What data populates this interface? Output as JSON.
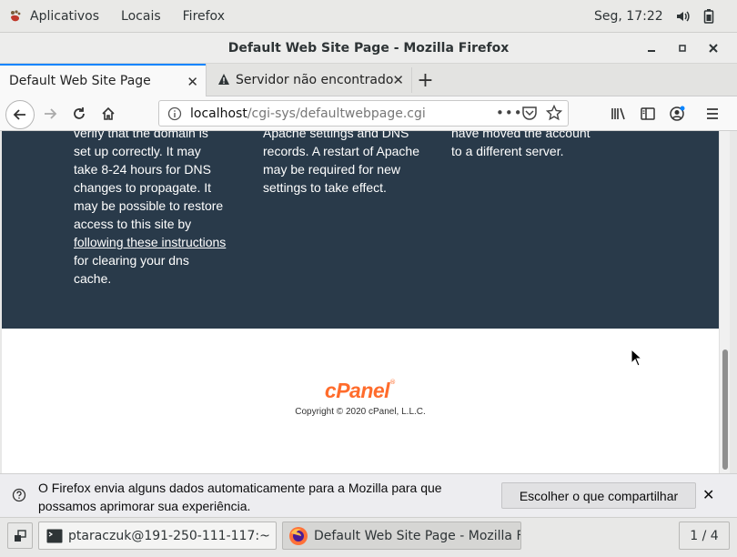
{
  "topbar": {
    "apps_label": "Aplicativos",
    "places_label": "Locais",
    "firefox_label": "Firefox",
    "clock": "Seg, 17:22"
  },
  "window": {
    "title": "Default Web Site Page - Mozilla Firefox"
  },
  "tabs": [
    {
      "label": "Default Web Site Page",
      "active": true
    },
    {
      "label": "Servidor não encontrado",
      "active": false
    }
  ],
  "urlbar": {
    "host": "localhost",
    "path": "/cgi-sys/defaultwebpage.cgi"
  },
  "page": {
    "col1": {
      "line0": "verify that the domain is",
      "text_before": "set up correctly. It may take 8-24 hours for DNS changes to propagate. It may be possible to restore access to this site by ",
      "link": "following these instructions",
      "text_after": " for clearing your dns cache."
    },
    "col2": {
      "text": "Apache settings and DNS records. A restart of Apache may be required for new settings to take effect."
    },
    "col3": {
      "text": "have moved the account to a different server."
    },
    "logo": "cPanel",
    "copyright": "Copyright © 2020 cPanel, L.L.C."
  },
  "notification": {
    "message": "O Firefox envia alguns dados automaticamente para a Mozilla para que possamos aprimorar sua experiência.",
    "button": "Escolher o que compartilhar"
  },
  "taskbar": {
    "terminal": "ptaraczuk@191-250-111-117:~",
    "firefox": "Default Web Site Page - Mozilla Fire...",
    "pager": "1 / 4"
  }
}
